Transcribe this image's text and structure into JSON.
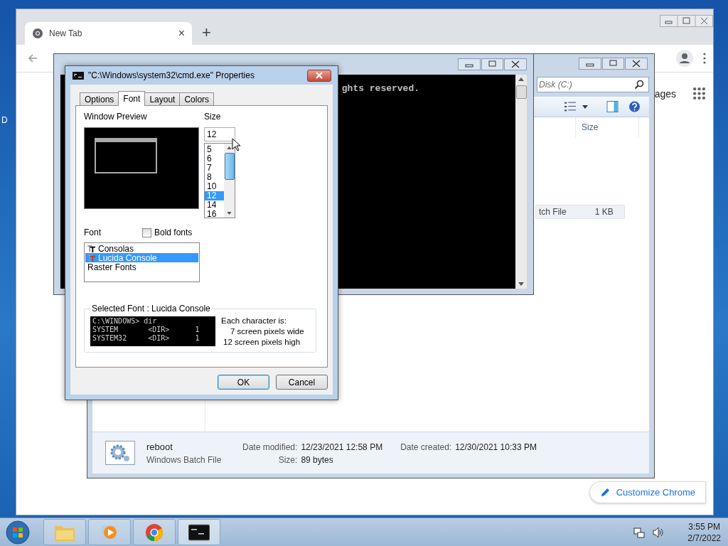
{
  "desktop": {
    "icon_label": "D"
  },
  "chrome": {
    "tab": {
      "title": "New Tab",
      "close": "×"
    },
    "new_tab": "+",
    "ntp_link": "ages",
    "customize": "Customize Chrome"
  },
  "explorer": {
    "search_placeholder": "Disk (C:)",
    "column": "Size",
    "file_row": {
      "type": "tch File",
      "size": "1 KB"
    },
    "details": {
      "name": "reboot",
      "type": "Windows Batch File",
      "modified_label": "Date modified:",
      "modified": "12/23/2021 12:58 PM",
      "created_label": "Date created:",
      "created": "12/30/2021 10:33 PM",
      "size_label": "Size:",
      "size": "89 bytes"
    }
  },
  "console": {
    "right_line": "ghts reserved."
  },
  "dialog": {
    "title": "\"C:\\Windows\\system32\\cmd.exe\" Properties",
    "tabs": [
      {
        "label": "Options",
        "selected": false
      },
      {
        "label": "Font",
        "selected": true
      },
      {
        "label": "Layout",
        "selected": false
      },
      {
        "label": "Colors",
        "selected": false
      }
    ],
    "preview_label": "Window Preview",
    "size_label": "Size",
    "size_value": "12",
    "sizes": [
      {
        "label": "5",
        "selected": false
      },
      {
        "label": "6",
        "selected": false
      },
      {
        "label": "7",
        "selected": false
      },
      {
        "label": "8",
        "selected": false
      },
      {
        "label": "10",
        "selected": false
      },
      {
        "label": "12",
        "selected": true
      },
      {
        "label": "14",
        "selected": false
      },
      {
        "label": "16",
        "selected": false
      }
    ],
    "font_label": "Font",
    "bold": {
      "label": "Bold fonts",
      "checked": false
    },
    "fonts": [
      {
        "label": "Consolas",
        "kind": "truetype",
        "selected": false
      },
      {
        "label": "Lucida Console",
        "kind": "truetype",
        "selected": true
      },
      {
        "label": "Raster Fonts",
        "kind": "raster",
        "selected": false
      }
    ],
    "selected_font": "Selected Font : Lucida Console",
    "sample_lines": [
      "C:\\WINDOWS> dir",
      "SYSTEM       <DIR>      1",
      "SYSTEM32     <DIR>      1"
    ],
    "char_info": [
      "Each character is:",
      "7 screen pixels wide",
      "12 screen pixels high"
    ],
    "buttons": [
      {
        "label": "OK",
        "kind": "default"
      },
      {
        "label": "Cancel",
        "kind": "normal"
      }
    ]
  },
  "taskbar": {
    "time": "3:55 PM",
    "date": "2/7/2022"
  }
}
